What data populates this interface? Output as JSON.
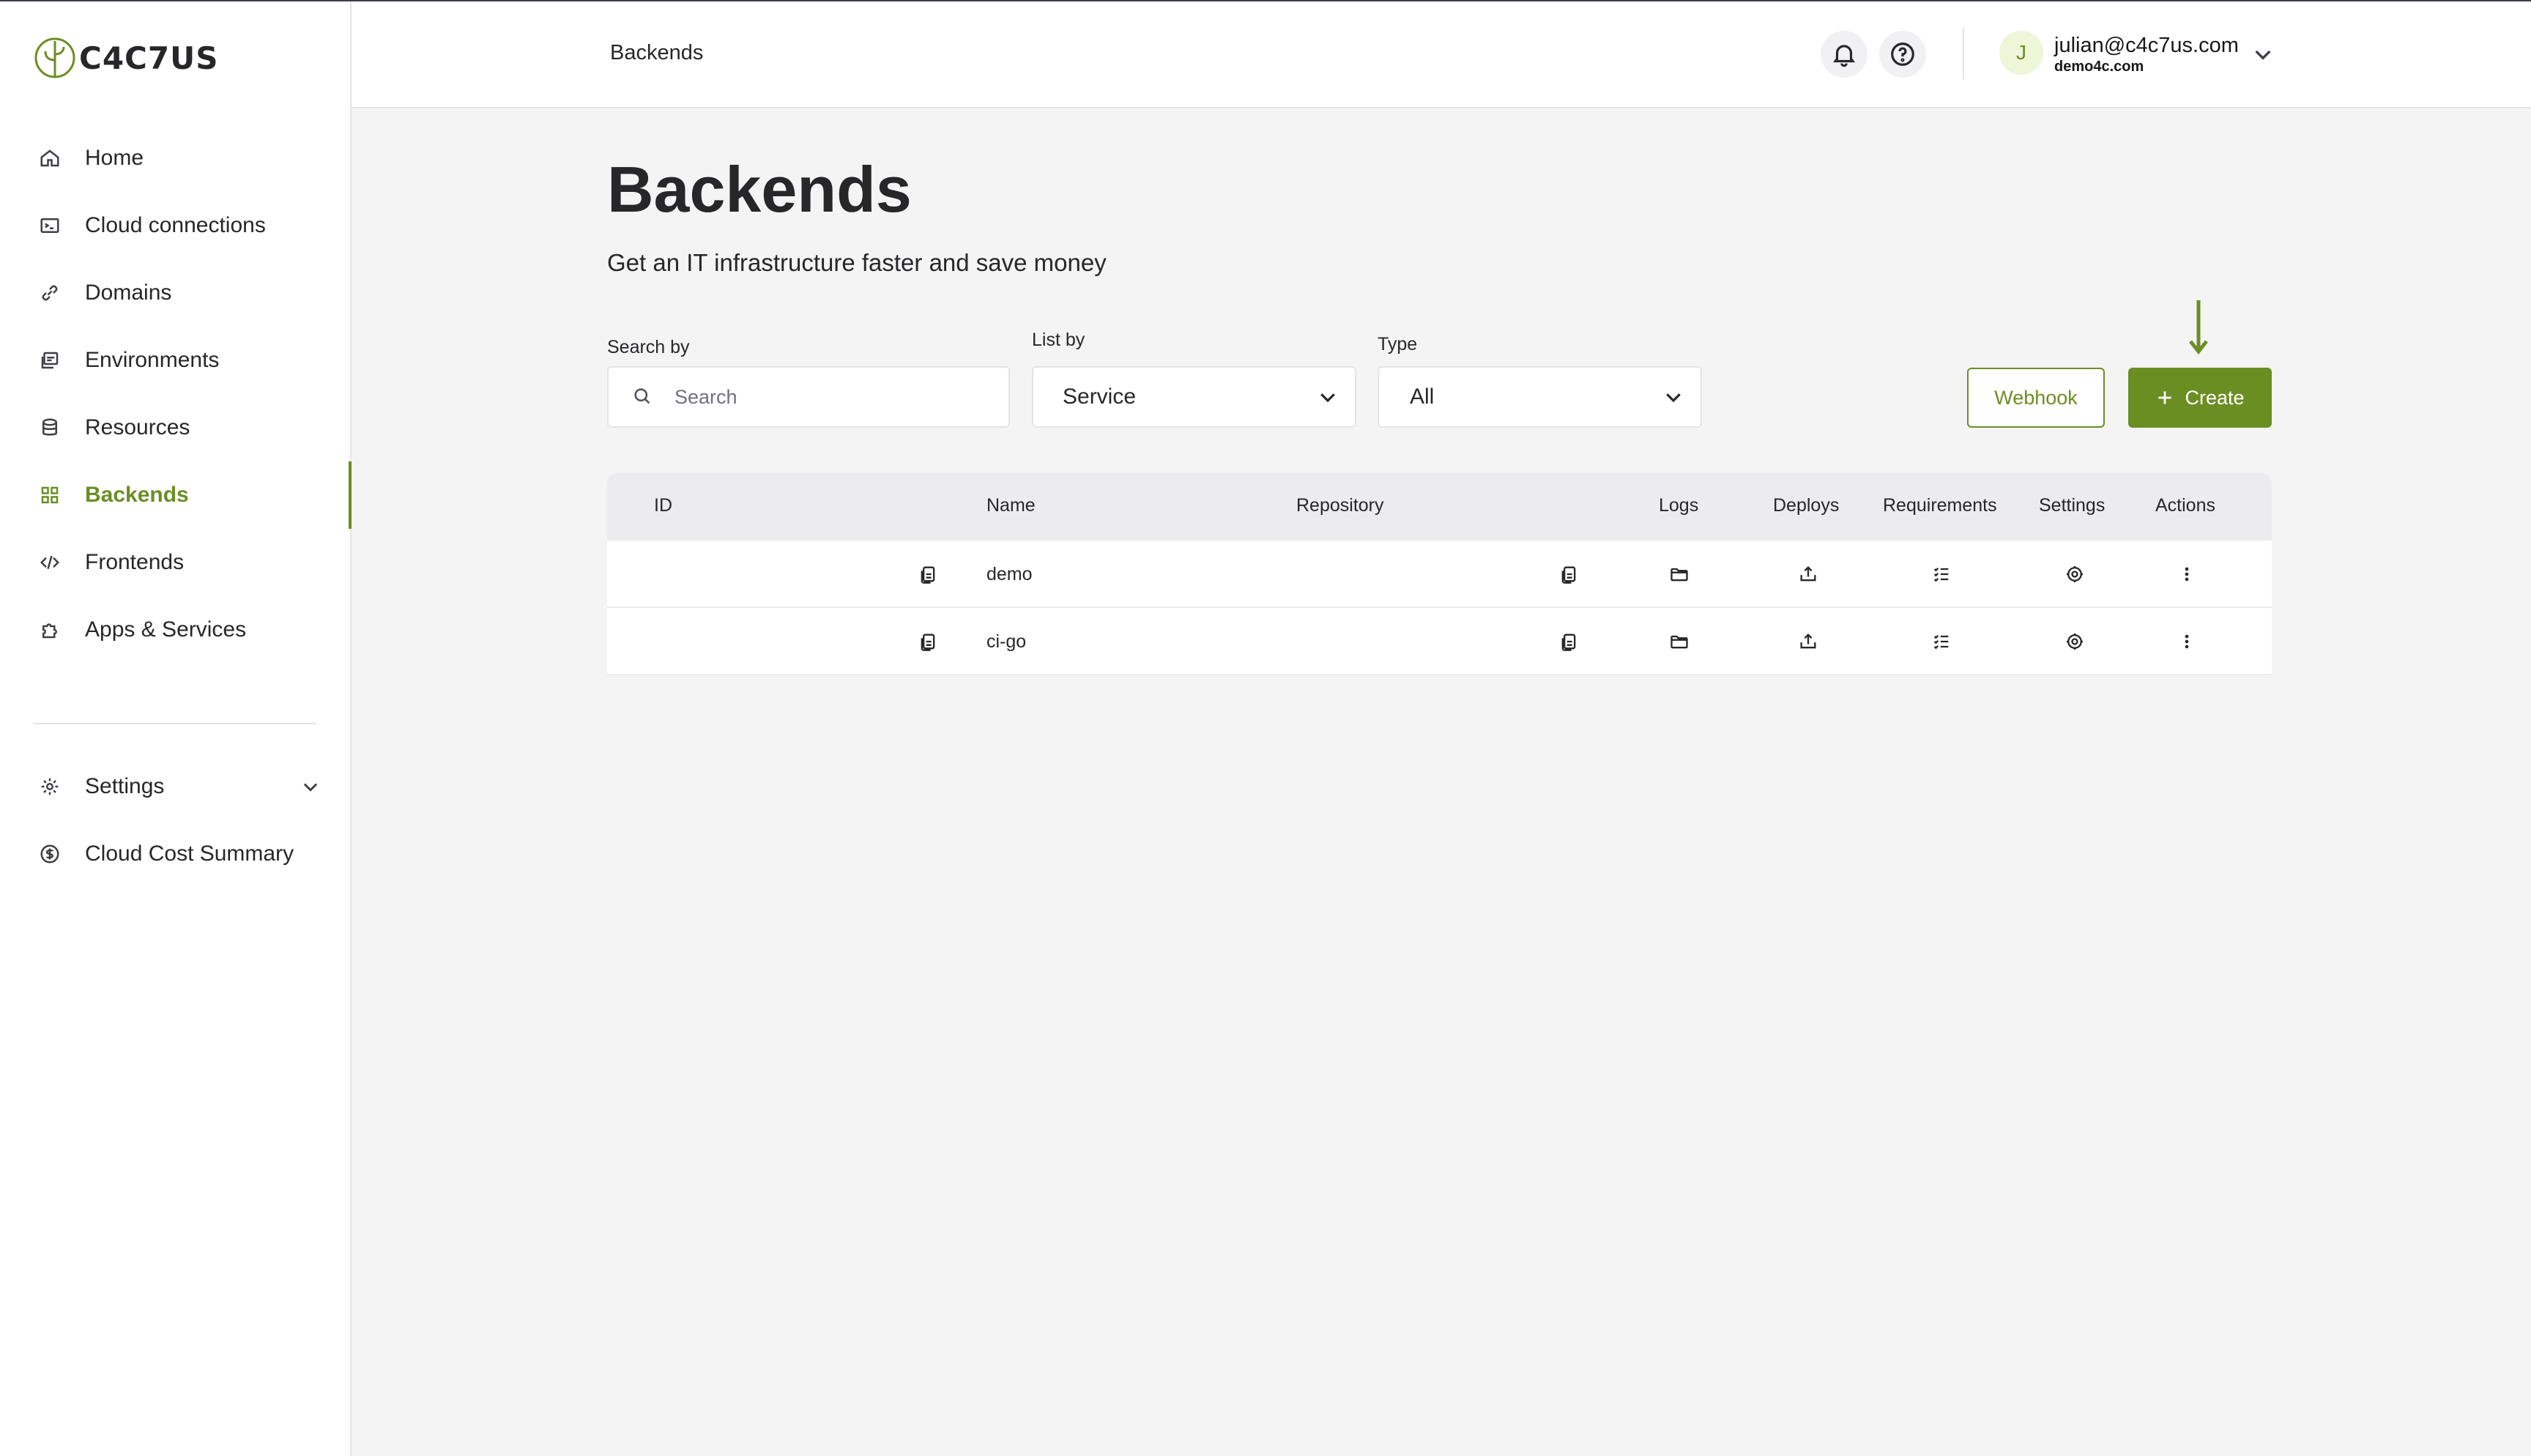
{
  "brand": {
    "name": "C4C7US"
  },
  "sidebar": {
    "items": [
      {
        "label": "Home",
        "icon": "home-icon"
      },
      {
        "label": "Cloud connections",
        "icon": "terminal-icon"
      },
      {
        "label": "Domains",
        "icon": "link-icon"
      },
      {
        "label": "Environments",
        "icon": "environments-icon"
      },
      {
        "label": "Resources",
        "icon": "database-icon"
      },
      {
        "label": "Backends",
        "icon": "grid-icon",
        "active": true
      },
      {
        "label": "Frontends",
        "icon": "code-icon"
      },
      {
        "label": "Apps & Services",
        "icon": "puzzle-icon"
      }
    ],
    "bottom": [
      {
        "label": "Settings",
        "icon": "gear-icon"
      },
      {
        "label": "Cloud Cost Summary",
        "icon": "dollar-circle-icon"
      }
    ]
  },
  "header": {
    "breadcrumb": "Backends",
    "user": {
      "initial": "J",
      "email": "julian@c4c7us.com",
      "org": "demo4c.com"
    }
  },
  "page": {
    "title": "Backends",
    "subtitle": "Get an IT infrastructure faster and save money"
  },
  "filters": {
    "search_label": "Search by",
    "search_placeholder": "Search",
    "list_by_label": "List by",
    "list_by_value": "Service",
    "type_label": "Type",
    "type_value": "All"
  },
  "actions": {
    "webhook": "Webhook",
    "create": "Create"
  },
  "table": {
    "columns": [
      "ID",
      "Name",
      "Repository",
      "Logs",
      "Deploys",
      "Requirements",
      "Settings",
      "Actions"
    ],
    "rows": [
      {
        "name": "demo"
      },
      {
        "name": "ci-go"
      }
    ]
  },
  "colors": {
    "accent": "#6b8e23",
    "background": "#f4f4f5",
    "text": "#27272a"
  }
}
